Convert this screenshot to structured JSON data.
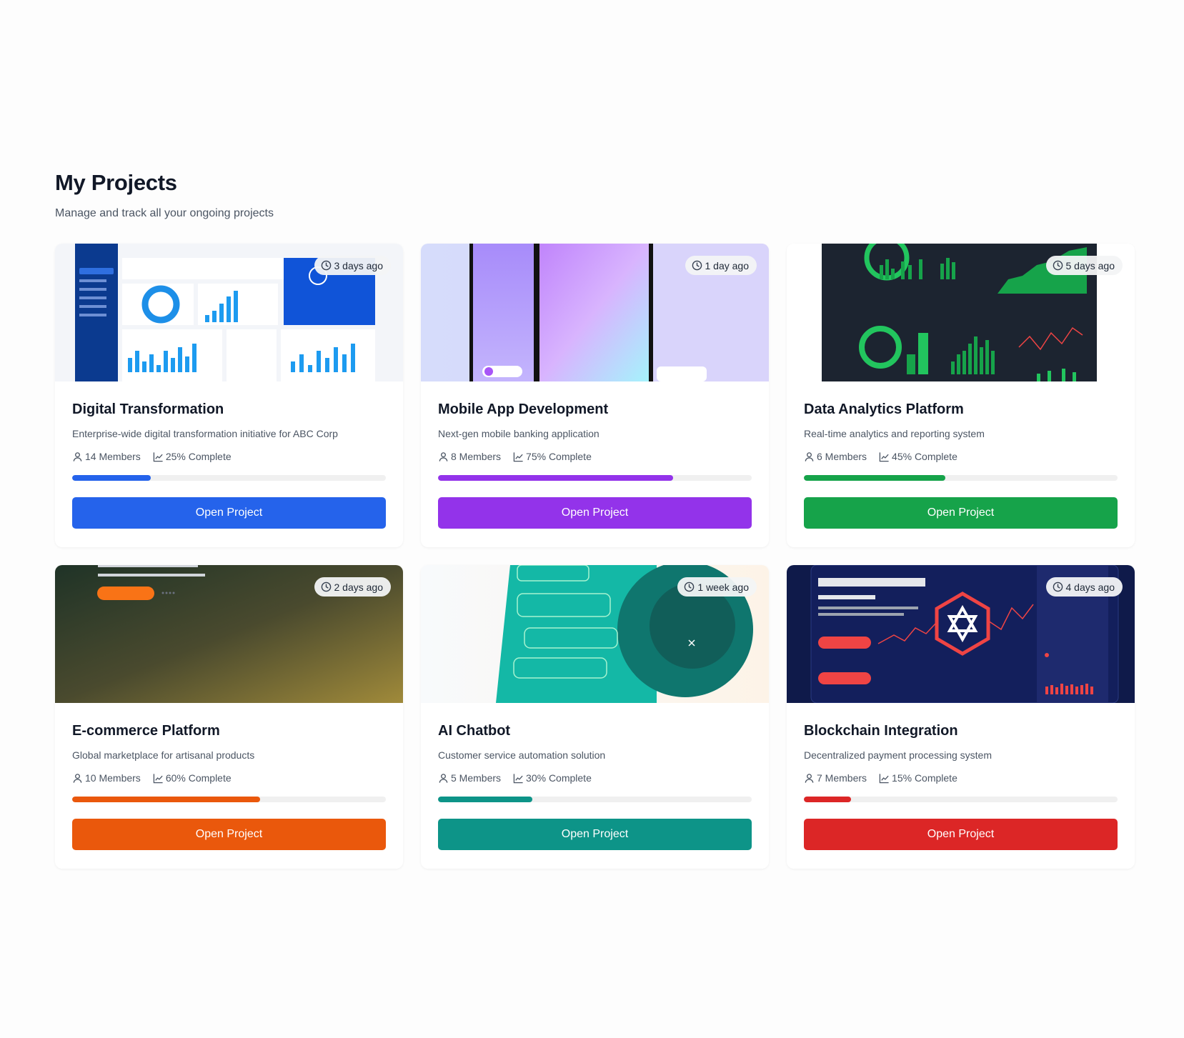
{
  "header": {
    "title": "My Projects",
    "subtitle": "Manage and track all your ongoing projects"
  },
  "projects": [
    {
      "title": "Digital Transformation",
      "description": "Enterprise-wide digital transformation initiative for ABC Corp",
      "members": "14 Members",
      "complete": "25% Complete",
      "progress": 0.25,
      "updated": "3 days ago",
      "button": "Open Project",
      "color": "#2563eb",
      "thumbnail": "dashboard-screenshot"
    },
    {
      "title": "Mobile App Development",
      "description": "Next-gen mobile banking application",
      "members": "8 Members",
      "complete": "75% Complete",
      "progress": 0.75,
      "updated": "1 day ago",
      "button": "Open Project",
      "color": "#9333ea",
      "thumbnail": "phone-mockups"
    },
    {
      "title": "Data Analytics Platform",
      "description": "Real-time analytics and reporting system",
      "members": "6 Members",
      "complete": "45% Complete",
      "progress": 0.45,
      "updated": "5 days ago",
      "button": "Open Project",
      "color": "#16a34a",
      "thumbnail": "analytics-dashboard"
    },
    {
      "title": "E-commerce Platform",
      "description": "Global marketplace for artisanal products",
      "members": "10 Members",
      "complete": "60% Complete",
      "progress": 0.6,
      "updated": "2 days ago",
      "button": "Open Project",
      "color": "#ea580c",
      "thumbnail": "storefront-hero"
    },
    {
      "title": "AI Chatbot",
      "description": "Customer service automation solution",
      "members": "5 Members",
      "complete": "30% Complete",
      "progress": 0.3,
      "updated": "1 week ago",
      "button": "Open Project",
      "color": "#0d9488",
      "thumbnail": "robot-chat"
    },
    {
      "title": "Blockchain Integration",
      "description": "Decentralized payment processing system",
      "members": "7 Members",
      "complete": "15% Complete",
      "progress": 0.15,
      "updated": "4 days ago",
      "button": "Open Project",
      "color": "#dc2626",
      "thumbnail": "crypto-dashboard"
    }
  ]
}
